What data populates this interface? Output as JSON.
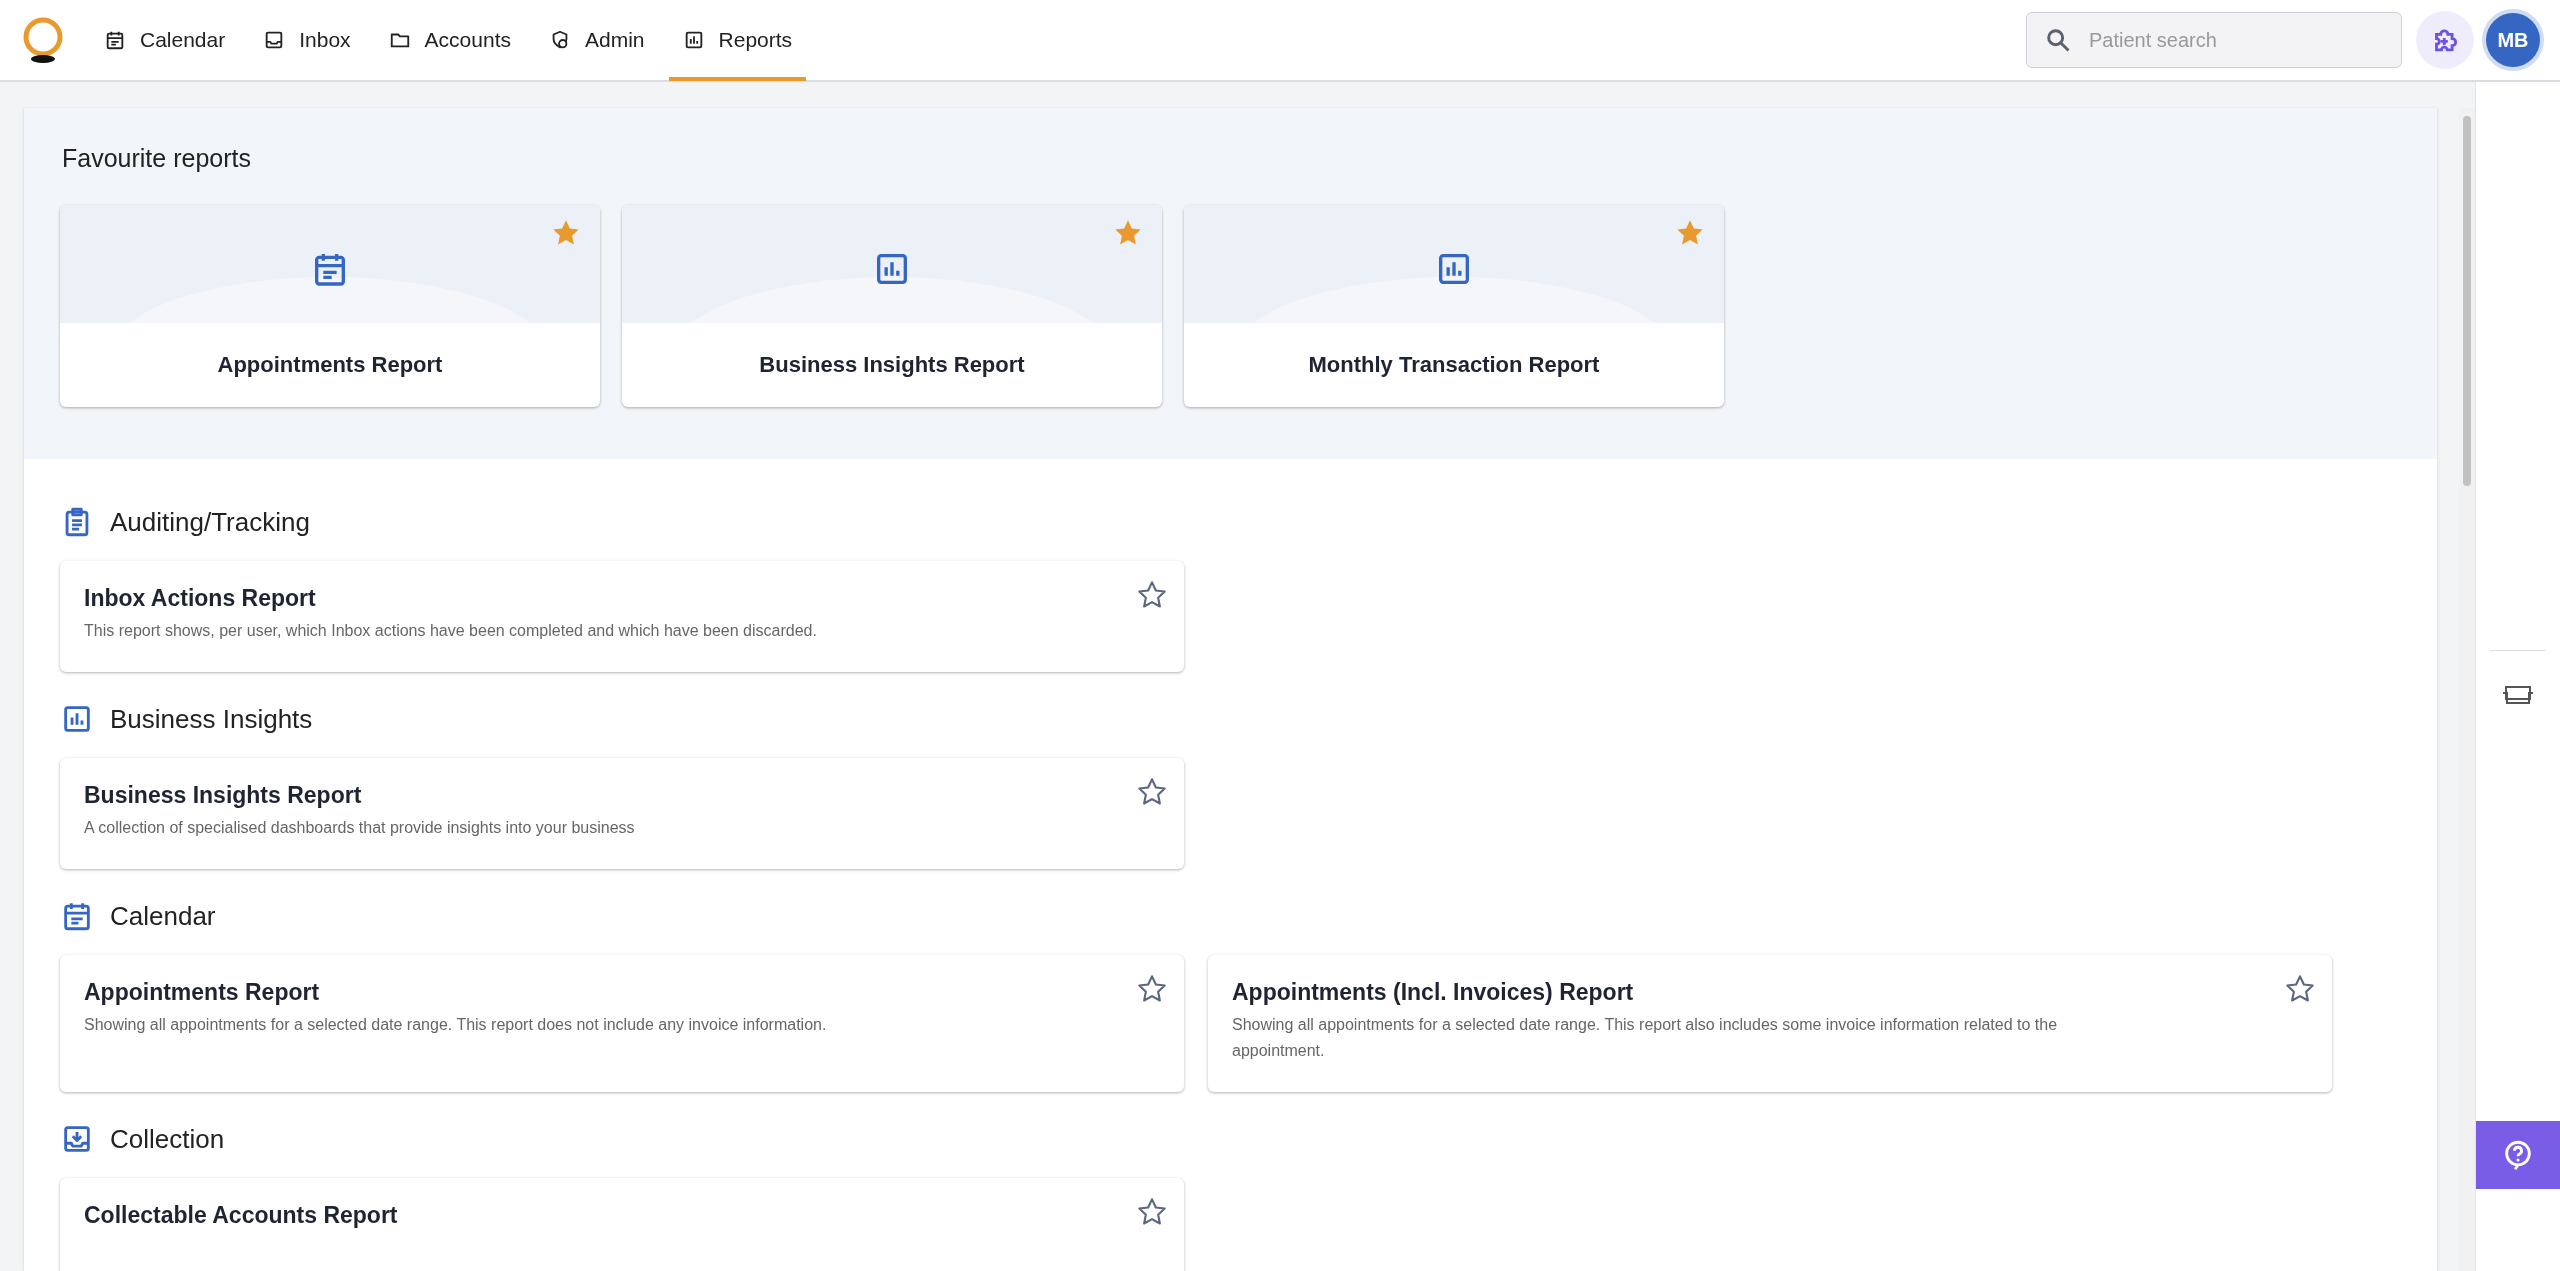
{
  "nav": {
    "items": [
      {
        "label": "Calendar",
        "selected": false
      },
      {
        "label": "Inbox",
        "selected": false
      },
      {
        "label": "Accounts",
        "selected": false
      },
      {
        "label": "Admin",
        "selected": false
      },
      {
        "label": "Reports",
        "selected": true
      }
    ],
    "search": {
      "placeholder": "Patient search"
    },
    "avatar": "MB"
  },
  "favourites": {
    "title": "Favourite reports",
    "cards": [
      {
        "title": "Appointments Report",
        "starred": true
      },
      {
        "title": "Business Insights Report",
        "starred": true
      },
      {
        "title": "Monthly Transaction Report",
        "starred": true
      }
    ]
  },
  "sections": [
    {
      "title": "Auditing/Tracking",
      "reports": [
        {
          "title": "Inbox Actions Report",
          "description": "This report shows, per user, which Inbox actions have been completed and which have been discarded.",
          "starred": false
        }
      ]
    },
    {
      "title": "Business Insights",
      "reports": [
        {
          "title": "Business Insights Report",
          "description": "A collection of specialised dashboards that provide insights into your business",
          "starred": false
        }
      ]
    },
    {
      "title": "Calendar",
      "reports": [
        {
          "title": "Appointments Report",
          "description": "Showing all appointments for a selected date range. This report does not include any invoice information.",
          "starred": false
        },
        {
          "title": "Appointments (Incl. Invoices) Report",
          "description": "Showing all appointments for a selected date range. This report also includes some invoice information related to the appointment.",
          "starred": false
        }
      ]
    },
    {
      "title": "Collection",
      "reports": [
        {
          "title": "Collectable Accounts Report",
          "starred": false
        }
      ]
    }
  ]
}
